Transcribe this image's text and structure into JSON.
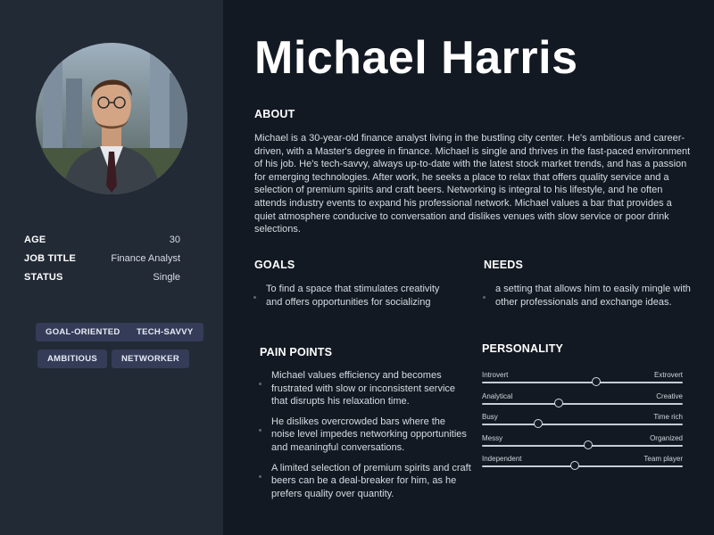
{
  "persona": {
    "name": "Michael Harris",
    "facts": [
      {
        "label": "AGE",
        "value": "30"
      },
      {
        "label": "JOB TITLE",
        "value": "Finance Analyst"
      },
      {
        "label": "STATUS",
        "value": "Single"
      }
    ],
    "tags": [
      "GOAL-ORIENTED",
      "TECH-SAVVY",
      "AMBITIOUS",
      "NETWORKER"
    ]
  },
  "about": {
    "heading": "ABOUT",
    "text": "Michael is a 30-year-old finance analyst living in the bustling city center. He's ambitious and career-driven, with a Master's degree in finance. Michael is single and thrives in the fast-paced environment of his job. He's tech-savvy, always up-to-date with the latest stock market trends, and has a passion for emerging technologies. After work, he seeks a place to relax that offers quality service and a selection of premium spirits and craft beers. Networking is integral to his lifestyle, and he often attends industry events to expand his professional network. Michael values a bar that provides a quiet atmosphere conducive to conversation and dislikes venues with slow service or poor drink selections."
  },
  "goals": {
    "heading": "GOALS",
    "items": [
      "To find a space that stimulates creativity and offers opportunities for socializing"
    ]
  },
  "needs": {
    "heading": "NEEDS",
    "items": [
      "a setting that allows him to easily mingle with other professionals and exchange ideas."
    ]
  },
  "pain_points": {
    "heading": "PAIN POINTS",
    "items": [
      "Michael values efficiency and becomes frustrated with slow or inconsistent service that disrupts his relaxation time.",
      "He dislikes overcrowded bars where the noise level impedes networking opportunities and meaningful conversations.",
      "A limited selection of premium spirits and craft beers can be a deal-breaker for him, as he prefers quality over quantity."
    ]
  },
  "personality": {
    "heading": "PERSONALITY",
    "traits": [
      {
        "left": "Introvert",
        "right": "Extrovert",
        "value": 0.57
      },
      {
        "left": "Analytical",
        "right": "Creative",
        "value": 0.38
      },
      {
        "left": "Busy",
        "right": "Time rich",
        "value": 0.28
      },
      {
        "left": "Messy",
        "right": "Organized",
        "value": 0.53
      },
      {
        "left": "Independent",
        "right": "Team player",
        "value": 0.46
      }
    ]
  },
  "colors": {
    "sidebar_bg": "#222a35",
    "main_bg": "#131922",
    "tag_bg": "#343c58"
  },
  "icons": {
    "avatar": "profile-photo"
  }
}
